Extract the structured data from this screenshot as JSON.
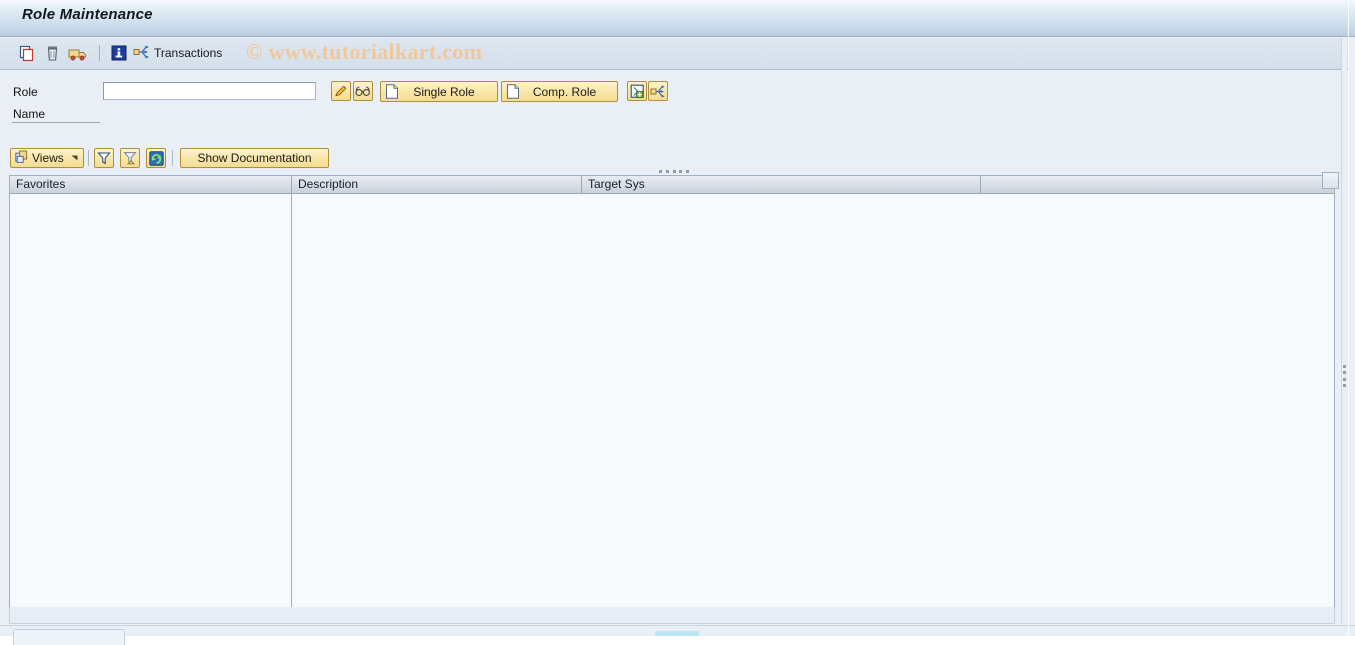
{
  "window": {
    "title": "Role Maintenance"
  },
  "watermark": {
    "text": "© www.tutorialkart.com"
  },
  "toolbar": {
    "copy_tooltip": "Copy Role",
    "delete_tooltip": "Delete Role",
    "transport_tooltip": "Transport Role",
    "info_tooltip": "Information",
    "transactions_label": "Transactions"
  },
  "selection": {
    "role_label": "Role",
    "role_value": "",
    "role_placeholder": "",
    "name_label": "Name",
    "name_value": "",
    "change_button_label": "",
    "display_button_label": "",
    "single_role_label": "Single Role",
    "comp_role_label": "Comp. Role",
    "assign_label": "",
    "derive_label": ""
  },
  "views_toolbar": {
    "views_label": "Views",
    "filter_label": "",
    "delete_filter_label": "",
    "refresh_label": "",
    "show_documentation_label": "Show Documentation"
  },
  "table": {
    "columns": [
      {
        "key": "favorites",
        "label": "Favorites"
      },
      {
        "key": "description",
        "label": "Description"
      },
      {
        "key": "target_sys",
        "label": "Target Sys"
      },
      {
        "key": "spare",
        "label": ""
      }
    ],
    "rows": []
  },
  "colors": {
    "title_gradient_top": "#f7fafd",
    "title_gradient_bottom": "#b9cde2",
    "toolbar_bg": "#d9e2ec",
    "button_gold": "#f8e6a8",
    "button_gold_border": "#b08f3c",
    "table_bg": "#f7fafd",
    "table_header_bg": "#d6dce3",
    "watermark_color": "#f0c79a",
    "page_bg": "#eaeff5"
  }
}
